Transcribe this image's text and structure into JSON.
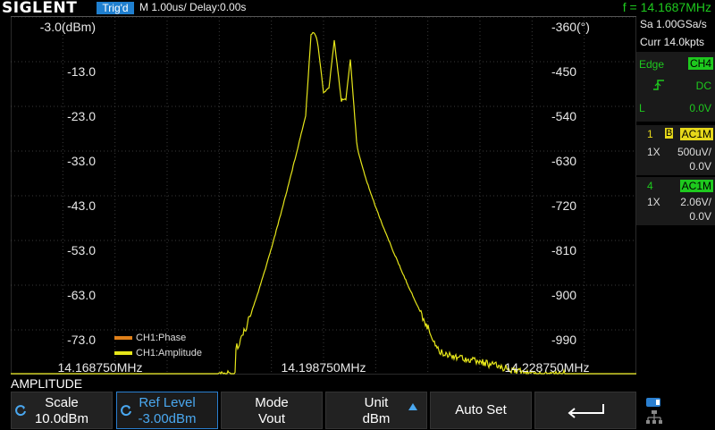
{
  "topbar": {
    "logo": "SIGLENT",
    "trigger_status": "Trig'd",
    "timebase": "M 1.00us/  Delay:0.00s",
    "frequency": "f = 14.1687MHz"
  },
  "plot": {
    "left_axis": [
      "-3.0(dBm)",
      "-13.0",
      "-23.0",
      "-33.0",
      "-43.0",
      "-53.0",
      "-63.0",
      "-73.0"
    ],
    "right_axis": [
      "-360(°)",
      "-450",
      "-540",
      "-630",
      "-720",
      "-810",
      "-900",
      "-990"
    ],
    "freq_labels": [
      "14.168750MHz",
      "14.198750MHz",
      "14.228750MHz"
    ],
    "legend": [
      {
        "label": "CH1:Phase",
        "color": "#e0801a"
      },
      {
        "label": "CH1:Amplitude",
        "color": "#e6e61a"
      }
    ],
    "trace_color": "#e6e61a"
  },
  "right_panel": {
    "sample_rate": "Sa 1.00GSa/s",
    "memory": "Curr 14.0kpts",
    "trigger": {
      "type": "Edge",
      "source": "CH4",
      "coupling": "DC",
      "level_label": "L",
      "level": "0.0V"
    },
    "ch1": {
      "num": "1",
      "bw": "B",
      "coupling": "AC1M",
      "probe": "1X",
      "scale": "500uV/",
      "offset": "0.0V"
    },
    "ch4": {
      "num": "4",
      "coupling": "AC1M",
      "probe": "1X",
      "scale": "2.06V/",
      "offset": "0.0V"
    }
  },
  "menu": {
    "title": "AMPLITUDE",
    "softkeys": [
      {
        "label": "Scale",
        "value": "10.0dBm"
      },
      {
        "label": "Ref Level",
        "value": "-3.00dBm"
      },
      {
        "label": "Mode",
        "value": "Vout"
      },
      {
        "label": "Unit",
        "value": "dBm"
      },
      {
        "label": "Auto Set",
        "value": ""
      }
    ]
  }
}
